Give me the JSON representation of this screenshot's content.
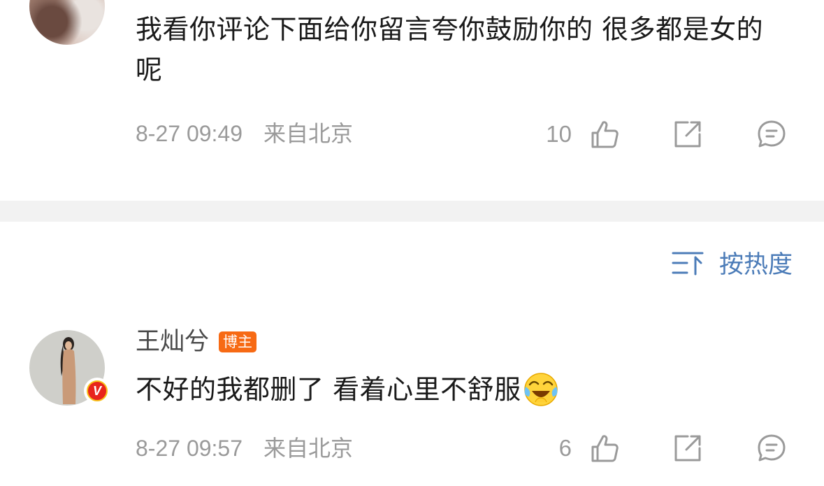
{
  "comments": [
    {
      "text": "我看你评论下面给你留言夸你鼓励你的 很多都是女的呢",
      "time": "8-27 09:49",
      "location": "来自北京",
      "likes": "10"
    },
    {
      "username": "王灿兮",
      "tag": "博主",
      "verified_badge": "V",
      "text": "不好的我都删了 看着心里不舒服",
      "emoji": "laugh-cry-icon",
      "time": "8-27 09:57",
      "location": "来自北京",
      "likes": "6"
    }
  ],
  "sort": {
    "label": "按热度",
    "icon": "sort-icon"
  },
  "colors": {
    "accent_blue": "#4c7cb8",
    "tag_orange": "#f76a14",
    "meta_gray": "#9a9a9a",
    "text": "#1a1a1a"
  }
}
